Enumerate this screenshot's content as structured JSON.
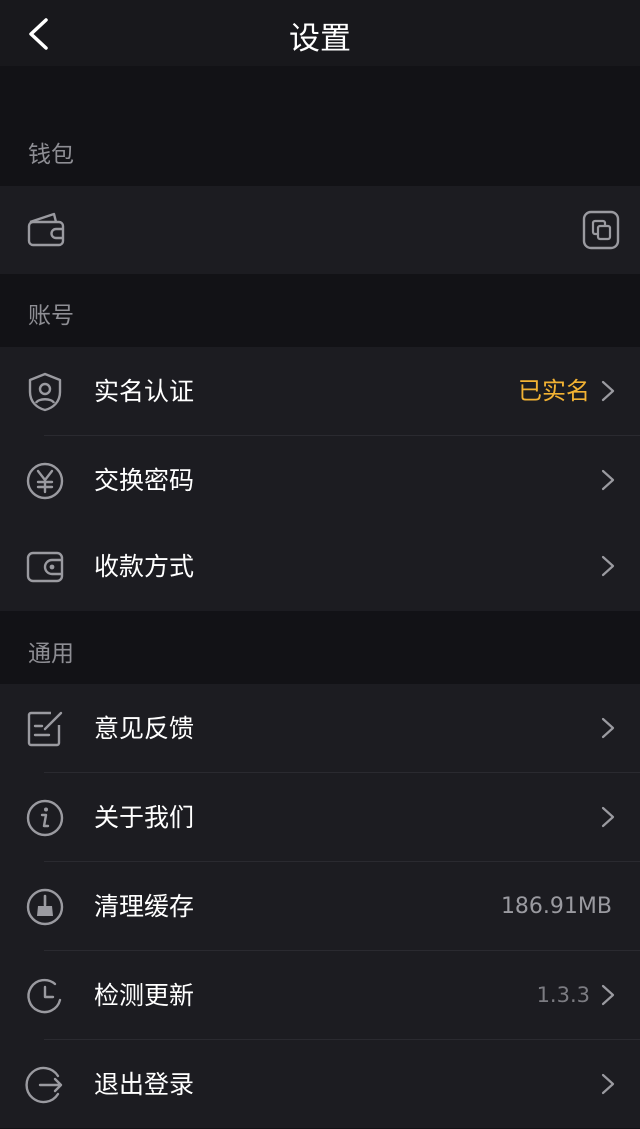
{
  "header": {
    "title": "设置",
    "back_icon": "chevron-left-icon"
  },
  "sections": {
    "wallet": {
      "title": "钱包"
    },
    "account": {
      "title": "账号",
      "items": [
        {
          "label": "实名认证",
          "value": "已实名",
          "icon": "shield-user-icon"
        },
        {
          "label": "交换密码",
          "value": "",
          "icon": "yen-circle-icon"
        },
        {
          "label": "收款方式",
          "value": "",
          "icon": "wallet-card-icon"
        }
      ]
    },
    "general": {
      "title": "通用",
      "items": [
        {
          "label": "意见反馈",
          "value": "",
          "icon": "edit-note-icon"
        },
        {
          "label": "关于我们",
          "value": "",
          "icon": "info-circle-icon"
        },
        {
          "label": "清理缓存",
          "value": "186.91MB",
          "icon": "broom-circle-icon"
        },
        {
          "label": "检测更新",
          "value": "1.3.3",
          "icon": "clock-icon"
        },
        {
          "label": "退出登录",
          "value": "",
          "icon": "logout-icon"
        }
      ]
    }
  },
  "colors": {
    "accent": "#f2b233",
    "background": "#121216",
    "row_bg": "#1c1c21",
    "muted": "#8e8e94"
  }
}
